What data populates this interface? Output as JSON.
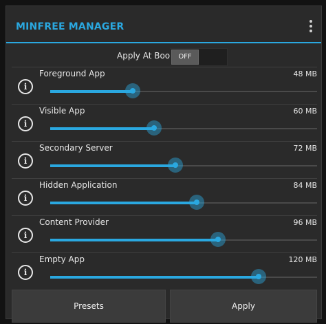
{
  "header": {
    "title": "MINFREE MANAGER",
    "menu_icon": "overflow-menu-icon"
  },
  "apply_at_boot": {
    "label": "Apply At Boot",
    "toggle_state": "OFF"
  },
  "sliders": [
    {
      "label": "Foreground App",
      "value": "48 MB",
      "level": 0.31
    },
    {
      "label": "Visible App",
      "value": "60 MB",
      "level": 0.39
    },
    {
      "label": "Secondary Server",
      "value": "72 MB",
      "level": 0.47
    },
    {
      "label": "Hidden Application",
      "value": "84 MB",
      "level": 0.55
    },
    {
      "label": "Content Provider",
      "value": "96 MB",
      "level": 0.63
    },
    {
      "label": "Empty App",
      "value": "120 MB",
      "level": 0.78
    }
  ],
  "buttons": {
    "presets": "Presets",
    "apply": "Apply"
  },
  "colors": {
    "accent": "#2aa8e0",
    "background": "#2a2a2a"
  }
}
